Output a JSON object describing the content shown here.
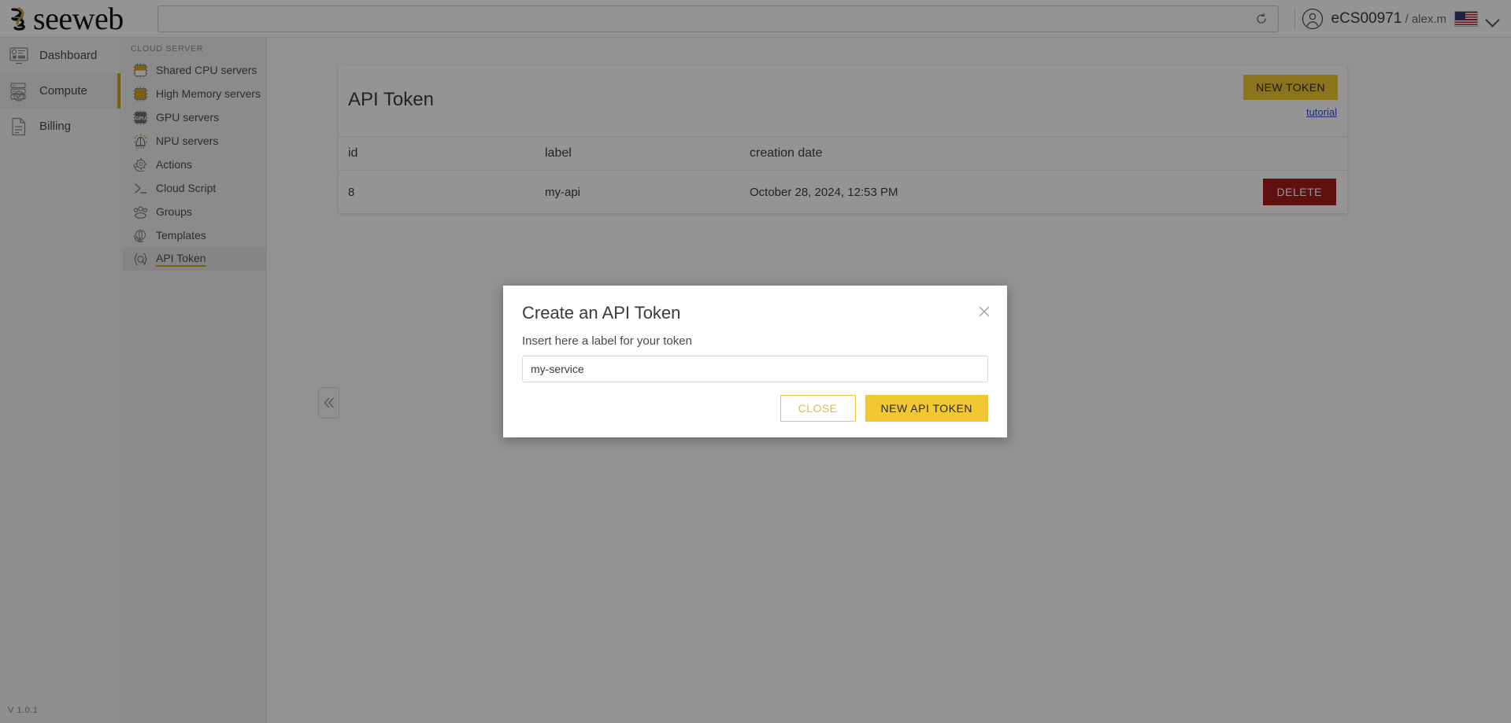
{
  "browser": {
    "url_value": "",
    "url_placeholder": "",
    "reload_icon": "reload-icon"
  },
  "brand": {
    "logo_word": "seeweb",
    "logo_mark": "seeweb-logo-mark",
    "accent": "#f2c832",
    "accent_dark": "#d4a81a"
  },
  "header": {
    "account": "eCS00971",
    "separator": "/",
    "username": "alex.m",
    "avatar_icon": "user-avatar-icon",
    "flag_icon": "us-flag-icon",
    "chevron_icon": "chevron-down-icon"
  },
  "leftnav": {
    "items": [
      {
        "label": "Dashboard",
        "icon": "dashboard-icon",
        "active": false
      },
      {
        "label": "Compute",
        "icon": "compute-servers-icon",
        "active": true
      },
      {
        "label": "Billing",
        "icon": "billing-document-icon",
        "active": false
      }
    ],
    "version": "V 1.0.1"
  },
  "subnav": {
    "title": "CLOUD SERVER",
    "items": [
      {
        "label": "Shared CPU servers",
        "icon": "cpu-chip-icon",
        "active": false
      },
      {
        "label": "High Memory servers",
        "icon": "memory-chip-icon",
        "active": false
      },
      {
        "label": "GPU servers",
        "icon": "gpu-chip-icon",
        "active": false
      },
      {
        "label": "NPU servers",
        "icon": "npu-chip-icon",
        "active": false
      },
      {
        "label": "Actions",
        "icon": "actions-gear-icon",
        "active": false
      },
      {
        "label": "Cloud Script",
        "icon": "terminal-prompt-icon",
        "active": false
      },
      {
        "label": "Groups",
        "icon": "groups-people-icon",
        "active": false
      },
      {
        "label": "Templates",
        "icon": "templates-icon",
        "active": false
      },
      {
        "label": "API Token",
        "icon": "api-token-icon",
        "active": true
      }
    ]
  },
  "collapse": {
    "icon": "double-chevron-left-icon"
  },
  "panel": {
    "title": "API Token",
    "new_token_label": "NEW TOKEN",
    "tutorial_label": "tutorial",
    "columns": [
      "id",
      "label",
      "creation date"
    ],
    "rows": [
      {
        "id": "8",
        "label": "my-api",
        "creation_date": "October 28, 2024, 12:53 PM",
        "action_label": "DELETE"
      }
    ]
  },
  "modal": {
    "title": "Create an API Token",
    "description": "Insert here a label for your token",
    "input_value": "my-service",
    "input_placeholder": "",
    "close_label": "CLOSE",
    "submit_label": "NEW API TOKEN",
    "close_icon": "close-x-icon"
  }
}
